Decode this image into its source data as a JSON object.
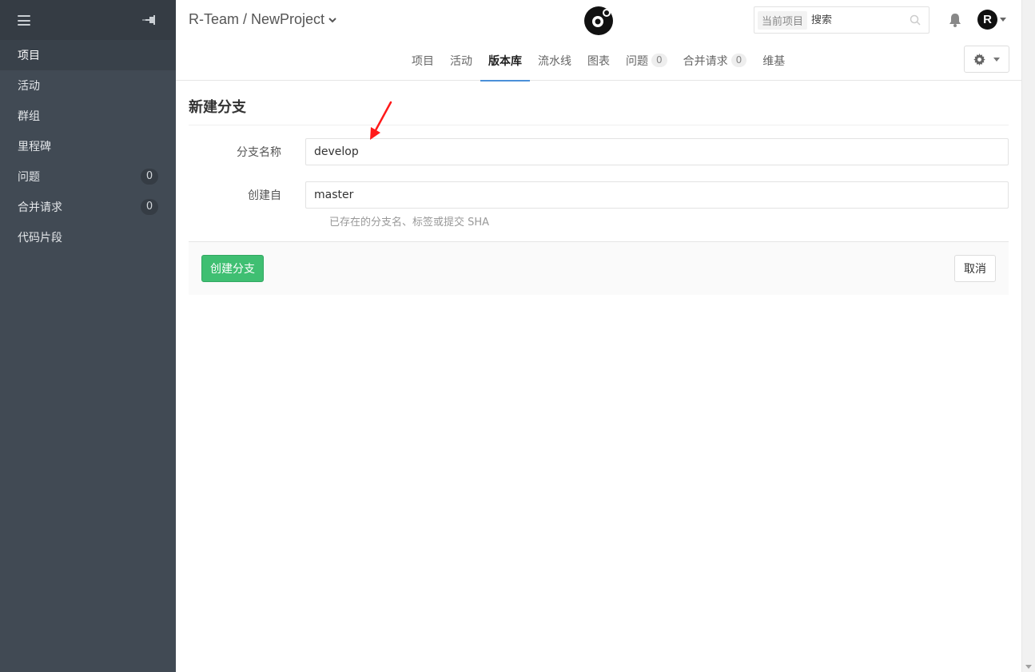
{
  "sidebar": {
    "items": [
      {
        "label": "项目",
        "active": true
      },
      {
        "label": "活动"
      },
      {
        "label": "群组"
      },
      {
        "label": "里程碑"
      },
      {
        "label": "问题",
        "count": "0"
      },
      {
        "label": "合并请求",
        "count": "0"
      },
      {
        "label": "代码片段"
      }
    ]
  },
  "header": {
    "breadcrumb": "R-Team / NewProject",
    "search": {
      "scope": "当前项目",
      "placeholder": "搜索"
    },
    "avatar_letter": "R"
  },
  "tabs": [
    {
      "label": "项目"
    },
    {
      "label": "活动"
    },
    {
      "label": "版本库",
      "active": true
    },
    {
      "label": "流水线"
    },
    {
      "label": "图表"
    },
    {
      "label": "问题",
      "count": "0"
    },
    {
      "label": "合并请求",
      "count": "0"
    },
    {
      "label": "维基"
    }
  ],
  "form": {
    "title": "新建分支",
    "branch_name_label": "分支名称",
    "branch_name_value": "develop",
    "create_from_label": "创建自",
    "create_from_value": "master",
    "create_from_help": "已存在的分支名、标签或提交 SHA",
    "create_button": "创建分支",
    "cancel_button": "取消"
  },
  "colors": {
    "sidebar_bg": "#414a54",
    "primary_green": "#3fbf72",
    "active_tab": "#4a90d9",
    "annotation": "#ff1a1a"
  }
}
